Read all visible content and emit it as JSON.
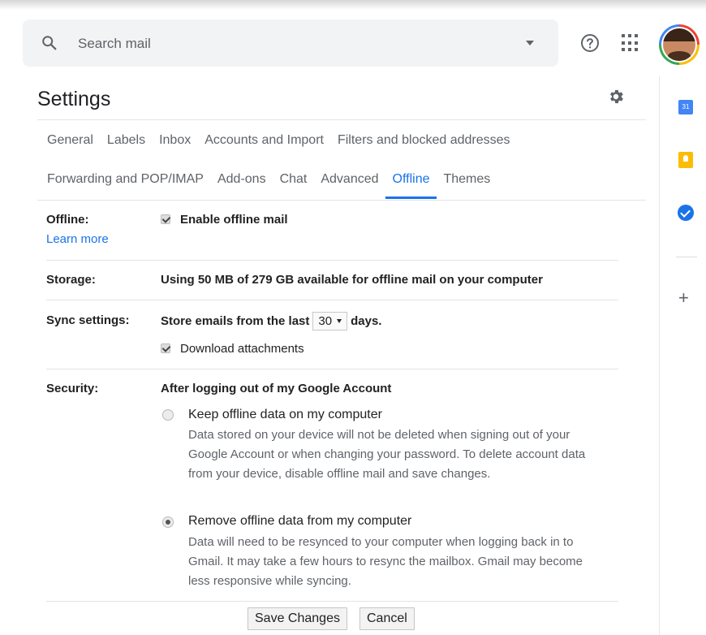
{
  "search": {
    "placeholder": "Search mail"
  },
  "settings": {
    "title": "Settings"
  },
  "tabs": {
    "row1": [
      "General",
      "Labels",
      "Inbox",
      "Accounts and Import",
      "Filters and blocked addresses"
    ],
    "row2": [
      "Forwarding and POP/IMAP",
      "Add-ons",
      "Chat",
      "Advanced",
      "Offline",
      "Themes"
    ],
    "active": "Offline"
  },
  "offline": {
    "label": "Offline:",
    "enable_label": "Enable offline mail",
    "enable_checked": true,
    "learn_more": "Learn more"
  },
  "storage": {
    "label": "Storage:",
    "text": "Using 50 MB of 279 GB available for offline mail on your computer"
  },
  "sync": {
    "label": "Sync settings:",
    "prefix": "Store emails from the last",
    "days_value": "30",
    "suffix": "days.",
    "download_label": "Download attachments",
    "download_checked": true
  },
  "security": {
    "label": "Security:",
    "heading": "After logging out of my Google Account",
    "option1_title": "Keep offline data on my computer",
    "option1_desc": "Data stored on your device will not be deleted when signing out of your Google Account or when changing your password. To delete account data from your device, disable offline mail and save changes.",
    "option1_selected": false,
    "option2_title": "Remove offline data from my computer",
    "option2_desc": "Data will need to be resynced to your computer when logging back in to Gmail. It may take a few hours to resync the mailbox. Gmail may become less responsive while syncing.",
    "option2_selected": true
  },
  "buttons": {
    "save": "Save Changes",
    "cancel": "Cancel"
  },
  "icons": {
    "search": "search-icon",
    "help": "help-icon",
    "apps": "apps-grid-icon",
    "settings": "gear-icon",
    "calendar": "calendar-icon",
    "keep": "keep-icon",
    "tasks": "tasks-icon",
    "add": "plus-icon"
  },
  "colors": {
    "accent": "#1a73e8",
    "search_bg": "#f1f3f4"
  }
}
